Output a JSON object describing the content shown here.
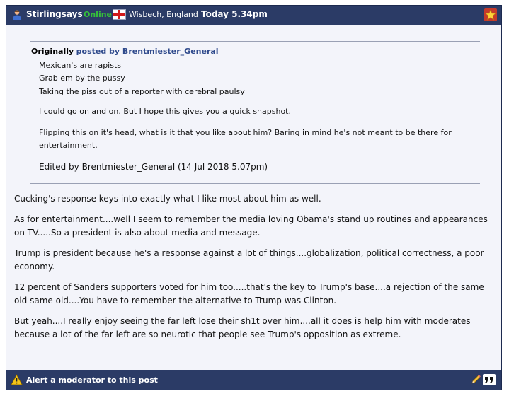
{
  "header": {
    "username": "Stirlingsays",
    "status": "Online",
    "location": "Wisbech, England",
    "timestamp": "Today 5.34pm"
  },
  "quote": {
    "originally": "Originally",
    "posted_by": "posted by Brentmiester_General",
    "lines": [
      "Mexican's are rapists",
      "Grab em by the pussy",
      "Taking the piss out of a reporter with cerebral paulsy"
    ],
    "para1": "I could go on and on. But I hope this gives you a quick snapshot.",
    "para2": "Flipping this on it's head, what is it that you like about him? Baring in mind he's not meant to be there for entertainment.",
    "edited": "Edited by Brentmiester_General (14 Jul 2018 5.07pm)"
  },
  "body": {
    "paragraphs": [
      "Cucking's response keys into exactly what I like most about him as well.",
      "As for entertainment....well I seem to remember the media loving Obama's stand up routines and appearances on TV.....So a president is also about media and message.",
      "Trump is president because he's a response against a lot of things....globalization, political correctness, a poor economy.",
      "12 percent of Sanders supporters voted for him too.....that's the key to Trump's base....a rejection of the same old same old....You have to remember the alternative to Trump was Clinton.",
      "But yeah....I really enjoy seeing the far left lose their sh1t over him....all it does is help him with moderates because a lot of the far left are so neurotic that people see Trump's opposition as extreme."
    ]
  },
  "footer": {
    "alert_label": "Alert a moderator to this post"
  },
  "icons": {
    "user": "user-icon",
    "flag": "england-flag-icon",
    "star": "star-icon",
    "warning": "warning-icon",
    "edit": "pencil-icon",
    "quote": "quote-icon"
  },
  "colors": {
    "header_bg": "#2b3b66",
    "post_bg": "#f3f4fa",
    "online": "#35c13a",
    "link": "#2f4a8c"
  }
}
